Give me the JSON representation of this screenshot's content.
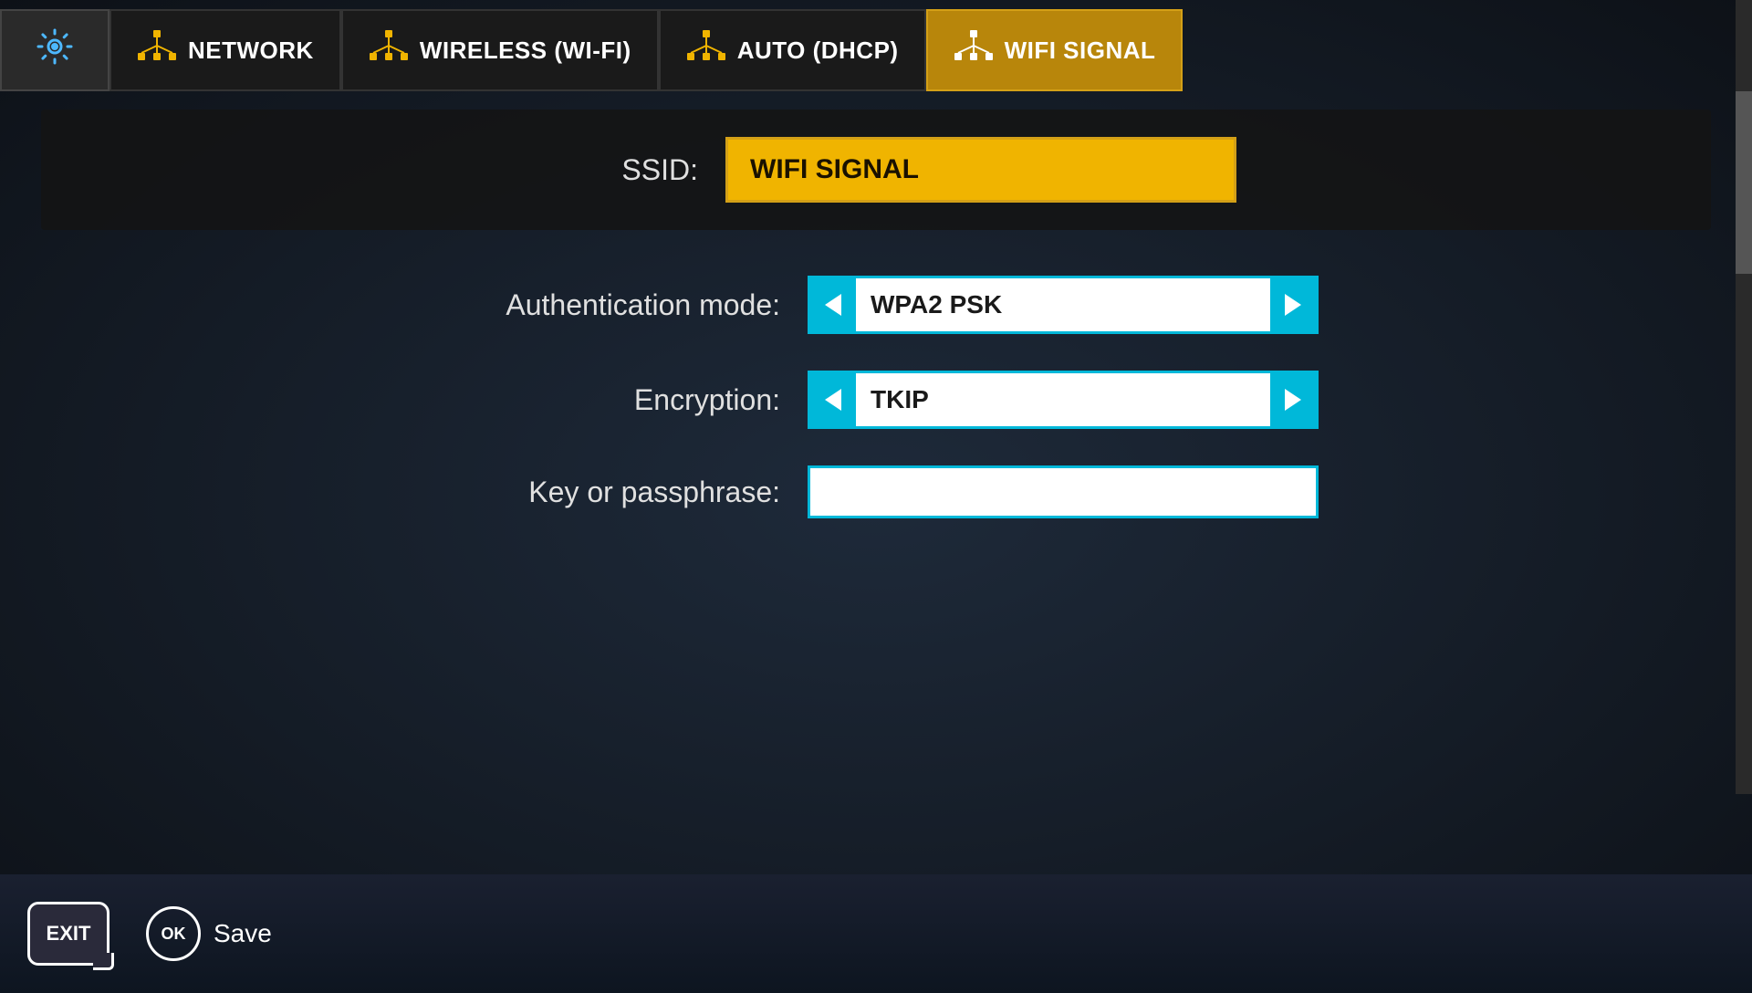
{
  "nav": {
    "tabs": [
      {
        "id": "settings",
        "label": "",
        "icon": "gear",
        "active": false
      },
      {
        "id": "network",
        "label": "Network",
        "icon": "network",
        "active": false
      },
      {
        "id": "wireless",
        "label": "Wireless (Wi-Fi)",
        "icon": "network",
        "active": false
      },
      {
        "id": "dhcp",
        "label": "Auto (DHCP)",
        "icon": "network",
        "active": false
      },
      {
        "id": "wifi-signal",
        "label": "WIFI SIGNAL",
        "icon": "network",
        "active": true
      }
    ]
  },
  "form": {
    "ssid_label": "SSID:",
    "ssid_value": "WIFI SIGNAL",
    "auth_label": "Authentication mode:",
    "auth_value": "WPA2 PSK",
    "encryption_label": "Encryption:",
    "encryption_value": "TKIP",
    "passphrase_label": "Key or passphrase:",
    "passphrase_value": "",
    "passphrase_placeholder": ""
  },
  "footer": {
    "exit_label": "EXIT",
    "ok_label": "OK",
    "save_label": "Save"
  },
  "colors": {
    "active_tab_bg": "#b8860b",
    "ssid_bg": "#f0b400",
    "selector_border": "#00b8d9",
    "selector_btn_bg": "#00b8d9"
  }
}
